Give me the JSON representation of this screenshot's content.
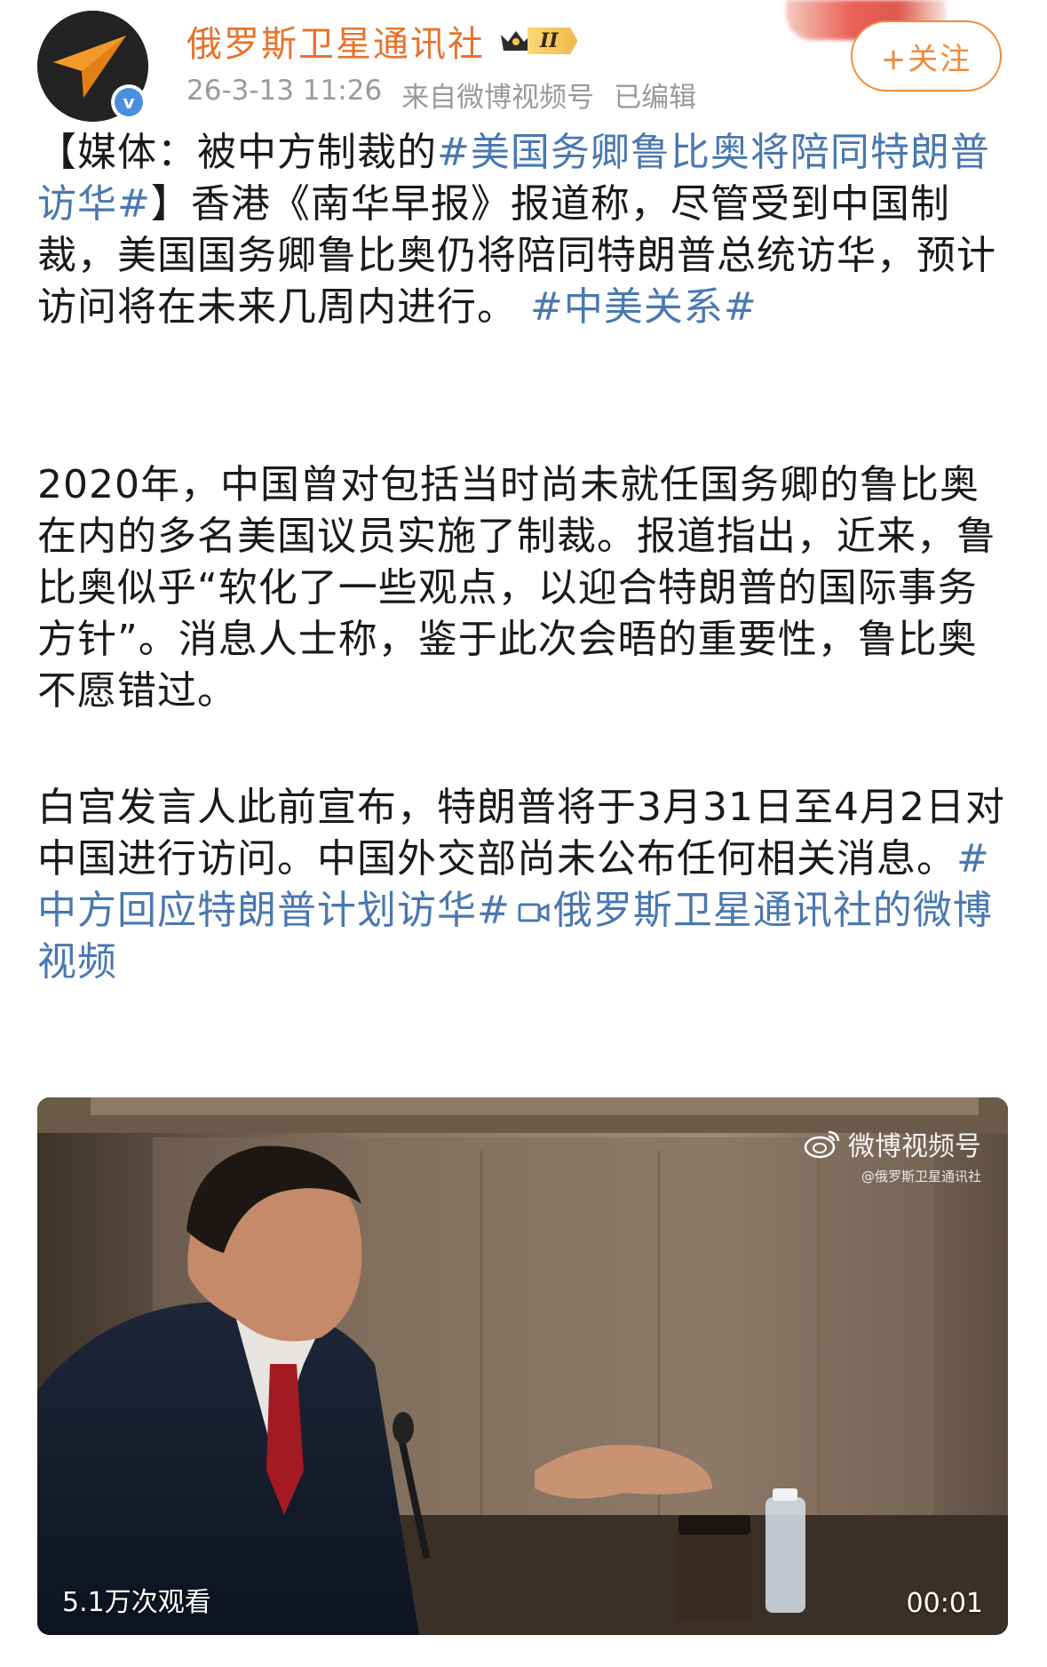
{
  "post": {
    "author": "俄罗斯卫星通讯社",
    "rank_label": "II",
    "timestamp": "26-3-13 11:26",
    "source": "来自微博视频号",
    "edited": "已编辑",
    "follow_label": "+关注"
  },
  "body": {
    "p1_open": "【媒体：被中方制裁的",
    "p1_hashtag1": "#美国务卿鲁比奥将陪同特朗普访华#",
    "p1_text": "】香港《南华早报》报道称，尽管受到中国制裁，美国国务卿鲁比奥仍将陪同特朗普总统访华，预计访问将在未来几周内进行。",
    "p1_hashtag2": "#中美关系#",
    "p2_text": "2020年，中国曾对包括当时尚未就任国务卿的鲁比奥在内的多名美国议员实施了制裁。报道指出，近来，鲁比奥似乎“软化了一些观点，以迎合特朗普的国际事务方针”。消息人士称，鉴于此次会晤的重要性，鲁比奥不愿错过。",
    "p3_text": "白宫发言人此前宣布，特朗普将于3月31日至4月2日对中国进行访问。中国外交部尚未公布任何相关消息。",
    "p3_hashtag": "#中方回应特朗普计划访华#",
    "p3_video_link": "俄罗斯卫星通讯社的微博视频"
  },
  "video": {
    "watermark_title": "微博视频号",
    "watermark_sub": "@俄罗斯卫星通讯社",
    "view_count": "5.1万次观看",
    "duration": "00:01"
  },
  "colors": {
    "username": "#e8722c",
    "link": "#4a78b0",
    "meta": "#9a9a9a",
    "follow": "#f08a3c"
  },
  "icons": [
    "avatar-logo-icon",
    "verified-icon",
    "crown-icon",
    "video-camera-icon",
    "weibo-logo-icon"
  ]
}
